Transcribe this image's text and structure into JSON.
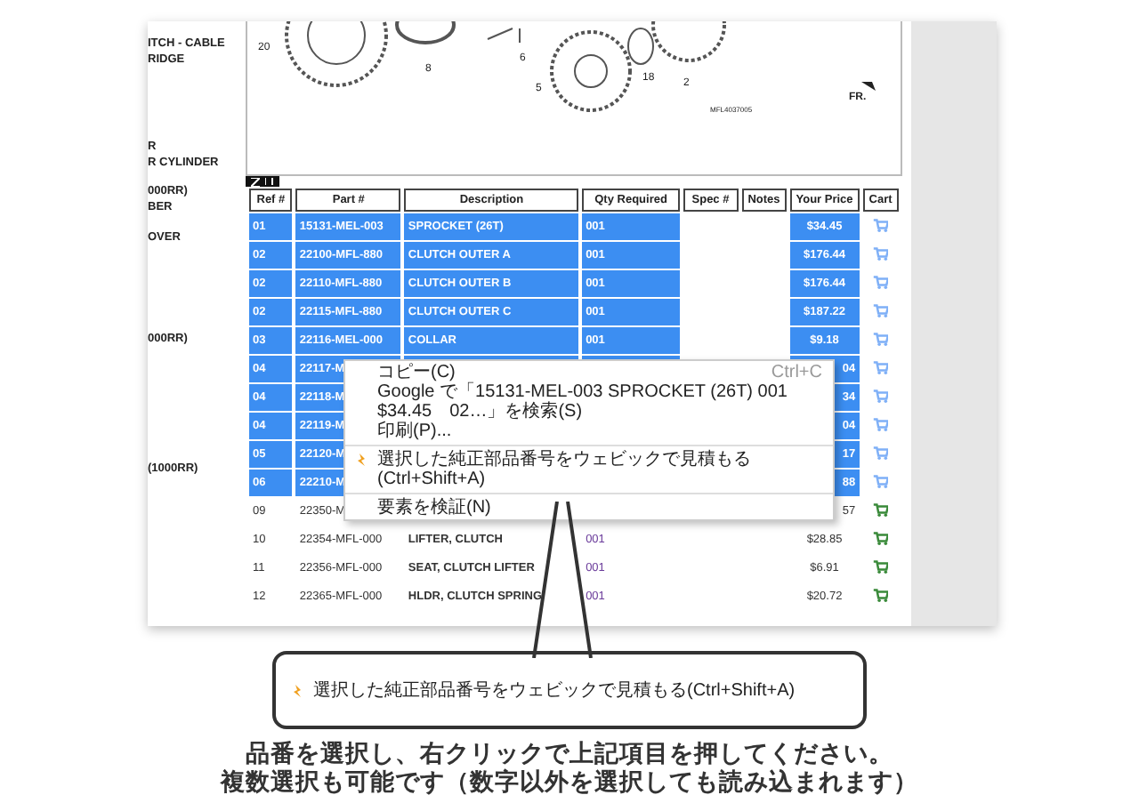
{
  "left_labels": [
    "ITCH - CABLE",
    "RIDGE",
    "R",
    "R CYLINDER",
    "000RR)",
    "BER",
    "OVER",
    "000RR)",
    "(1000RR)"
  ],
  "diagram": {
    "labels": [
      "20",
      "8",
      "6",
      "5",
      "18",
      "2",
      "MFL4037005",
      "FR."
    ]
  },
  "table": {
    "columns": [
      "Ref #",
      "Part #",
      "Description",
      "Qty Required",
      "Spec #",
      "Notes",
      "Your Price",
      "Cart"
    ],
    "rows": [
      {
        "ref": "01",
        "part": "15131-MEL-003",
        "description": "SPROCKET (26T)",
        "qty": "001",
        "price": "$34.45",
        "selected": true
      },
      {
        "ref": "02",
        "part": "22100-MFL-880",
        "description": "CLUTCH OUTER A",
        "qty": "001",
        "price": "$176.44",
        "selected": true
      },
      {
        "ref": "02",
        "part": "22110-MFL-880",
        "description": "CLUTCH OUTER B",
        "qty": "001",
        "price": "$176.44",
        "selected": true
      },
      {
        "ref": "02",
        "part": "22115-MFL-880",
        "description": "CLUTCH OUTER C",
        "qty": "001",
        "price": "$187.22",
        "selected": true
      },
      {
        "ref": "03",
        "part": "22116-MEL-000",
        "description": "COLLAR",
        "qty": "001",
        "price": "$9.18",
        "selected": true
      },
      {
        "ref": "04",
        "part": "22117-M",
        "price": "04",
        "selected": true
      },
      {
        "ref": "04",
        "part": "22118-M",
        "price": "34",
        "selected": true
      },
      {
        "ref": "04",
        "part": "22119-M",
        "price": "04",
        "selected": true
      },
      {
        "ref": "05",
        "part": "22120-M",
        "price": "17",
        "selected": true
      },
      {
        "ref": "06",
        "part": "22210-M",
        "price": "88",
        "selected": true
      },
      {
        "ref": "09",
        "part": "22350-M",
        "price": "57",
        "selected": false
      },
      {
        "ref": "10",
        "part": "22354-MFL-000",
        "description": "LIFTER, CLUTCH",
        "qty": "001",
        "price": "$28.85",
        "selected": false
      },
      {
        "ref": "11",
        "part": "22356-MFL-000",
        "description": "SEAT, CLUTCH LIFTER",
        "qty": "001",
        "price": "$6.91",
        "selected": false
      },
      {
        "ref": "12",
        "part": "22365-MFL-000",
        "description": "HLDR, CLUTCH SPRING",
        "qty": "001",
        "price": "$20.72",
        "selected": false
      }
    ]
  },
  "context_menu": {
    "items": [
      {
        "kind": "item",
        "label": "コピー(C)",
        "shortcut": "Ctrl+C"
      },
      {
        "kind": "item",
        "label": "Google で「15131-MEL-003 SPROCKET (26T) 001　$34.45　02…」を検索(S)"
      },
      {
        "kind": "item",
        "label": "印刷(P)..."
      },
      {
        "kind": "separator"
      },
      {
        "kind": "extension",
        "label": "選択した純正部品番号をウェビックで見積もる(Ctrl+Shift+A)"
      },
      {
        "kind": "separator"
      },
      {
        "kind": "item",
        "label": "要素を検証(N)"
      }
    ]
  },
  "callout": {
    "text": "選択した純正部品番号をウェビックで見積もる(Ctrl+Shift+A)"
  },
  "caption": [
    "品番を選択し、右クリックで上記項目を押してください。",
    "複数選択も可能です（数字以外を選択しても読み込まれます）"
  ]
}
